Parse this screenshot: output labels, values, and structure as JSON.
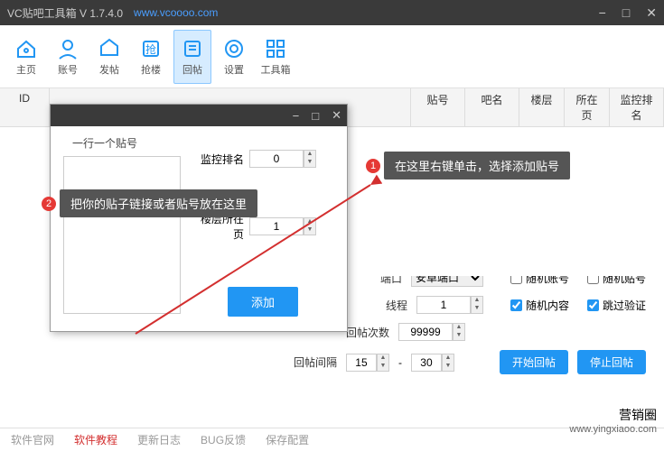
{
  "titlebar": {
    "title": "VC贴吧工具箱 V 1.7.4.0",
    "url": "www.vcoooo.com"
  },
  "toolbar": {
    "home": "主页",
    "account": "账号",
    "post": "发帖",
    "grab": "抢楼",
    "reply": "回帖",
    "settings": "设置",
    "toolbox": "工具箱"
  },
  "table": {
    "id": "ID",
    "tiehao": "贴号",
    "baming": "吧名",
    "louceng": "楼层",
    "page": "所在页",
    "monitor": "监控排名"
  },
  "tooltip1": {
    "num": "1",
    "text": "在这里右键单击，选择添加贴号"
  },
  "tooltip2": {
    "num": "2",
    "text": "把你的贴子链接或者贴号放在这里"
  },
  "dialog": {
    "header": "一行一个贴号",
    "rank_label": "监控排名",
    "rank_value": "0",
    "floor_label": "楼层所在页",
    "floor_value": "1",
    "add": "添加"
  },
  "bottom": {
    "port_label": "端口",
    "port_value": "安卓端口",
    "thread_label": "线程",
    "thread_value": "1",
    "count_label": "回帖次数",
    "count_value": "99999",
    "interval_label": "回帖间隔",
    "interval_min": "15",
    "interval_max": "30",
    "dash": "-",
    "chk_rand_account": "随机账号",
    "chk_rand_tie": "随机贴号",
    "chk_rand_content": "随机内容",
    "chk_skip_verify": "跳过验证",
    "start": "开始回帖",
    "stop": "停止回帖"
  },
  "footer": {
    "official": "软件官网",
    "tutorial": "软件教程",
    "changelog": "更新日志",
    "feedback": "BUG反馈",
    "save": "保存配置"
  },
  "watermark": {
    "line1": "营销圈",
    "line2": "www.yingxiaoo.com"
  }
}
